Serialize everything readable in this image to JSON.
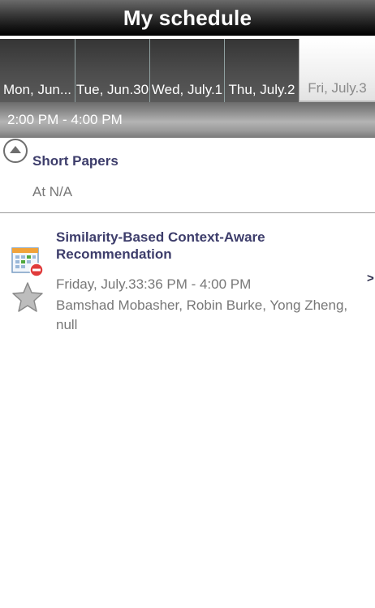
{
  "header": {
    "title": "My schedule"
  },
  "tabs": [
    {
      "label": "Mon, Jun...",
      "active": false
    },
    {
      "label": "Tue, Jun.30",
      "active": false
    },
    {
      "label": "Wed, July.1",
      "active": false
    },
    {
      "label": "Thu, July.2",
      "active": false
    },
    {
      "label": "Fri, July.3",
      "active": true
    }
  ],
  "timeslot": {
    "label": "2:00 PM - 4:00 PM"
  },
  "session": {
    "title": "Short Papers",
    "location": "At N/A"
  },
  "paper": {
    "title": "Similarity-Based Context-Aware Recommendation",
    "time": "Friday, July.33:36 PM - 4:00 PM",
    "authors": "Bamshad Mobasher, Robin Burke, Yong Zheng, null",
    "chevron": ">"
  },
  "icons": {
    "calendar_remove": "calendar-remove-icon",
    "star": "star-icon",
    "collapse": "collapse-up-icon"
  },
  "colors": {
    "title_text": "#3d3d6b",
    "secondary_text": "#777777"
  }
}
